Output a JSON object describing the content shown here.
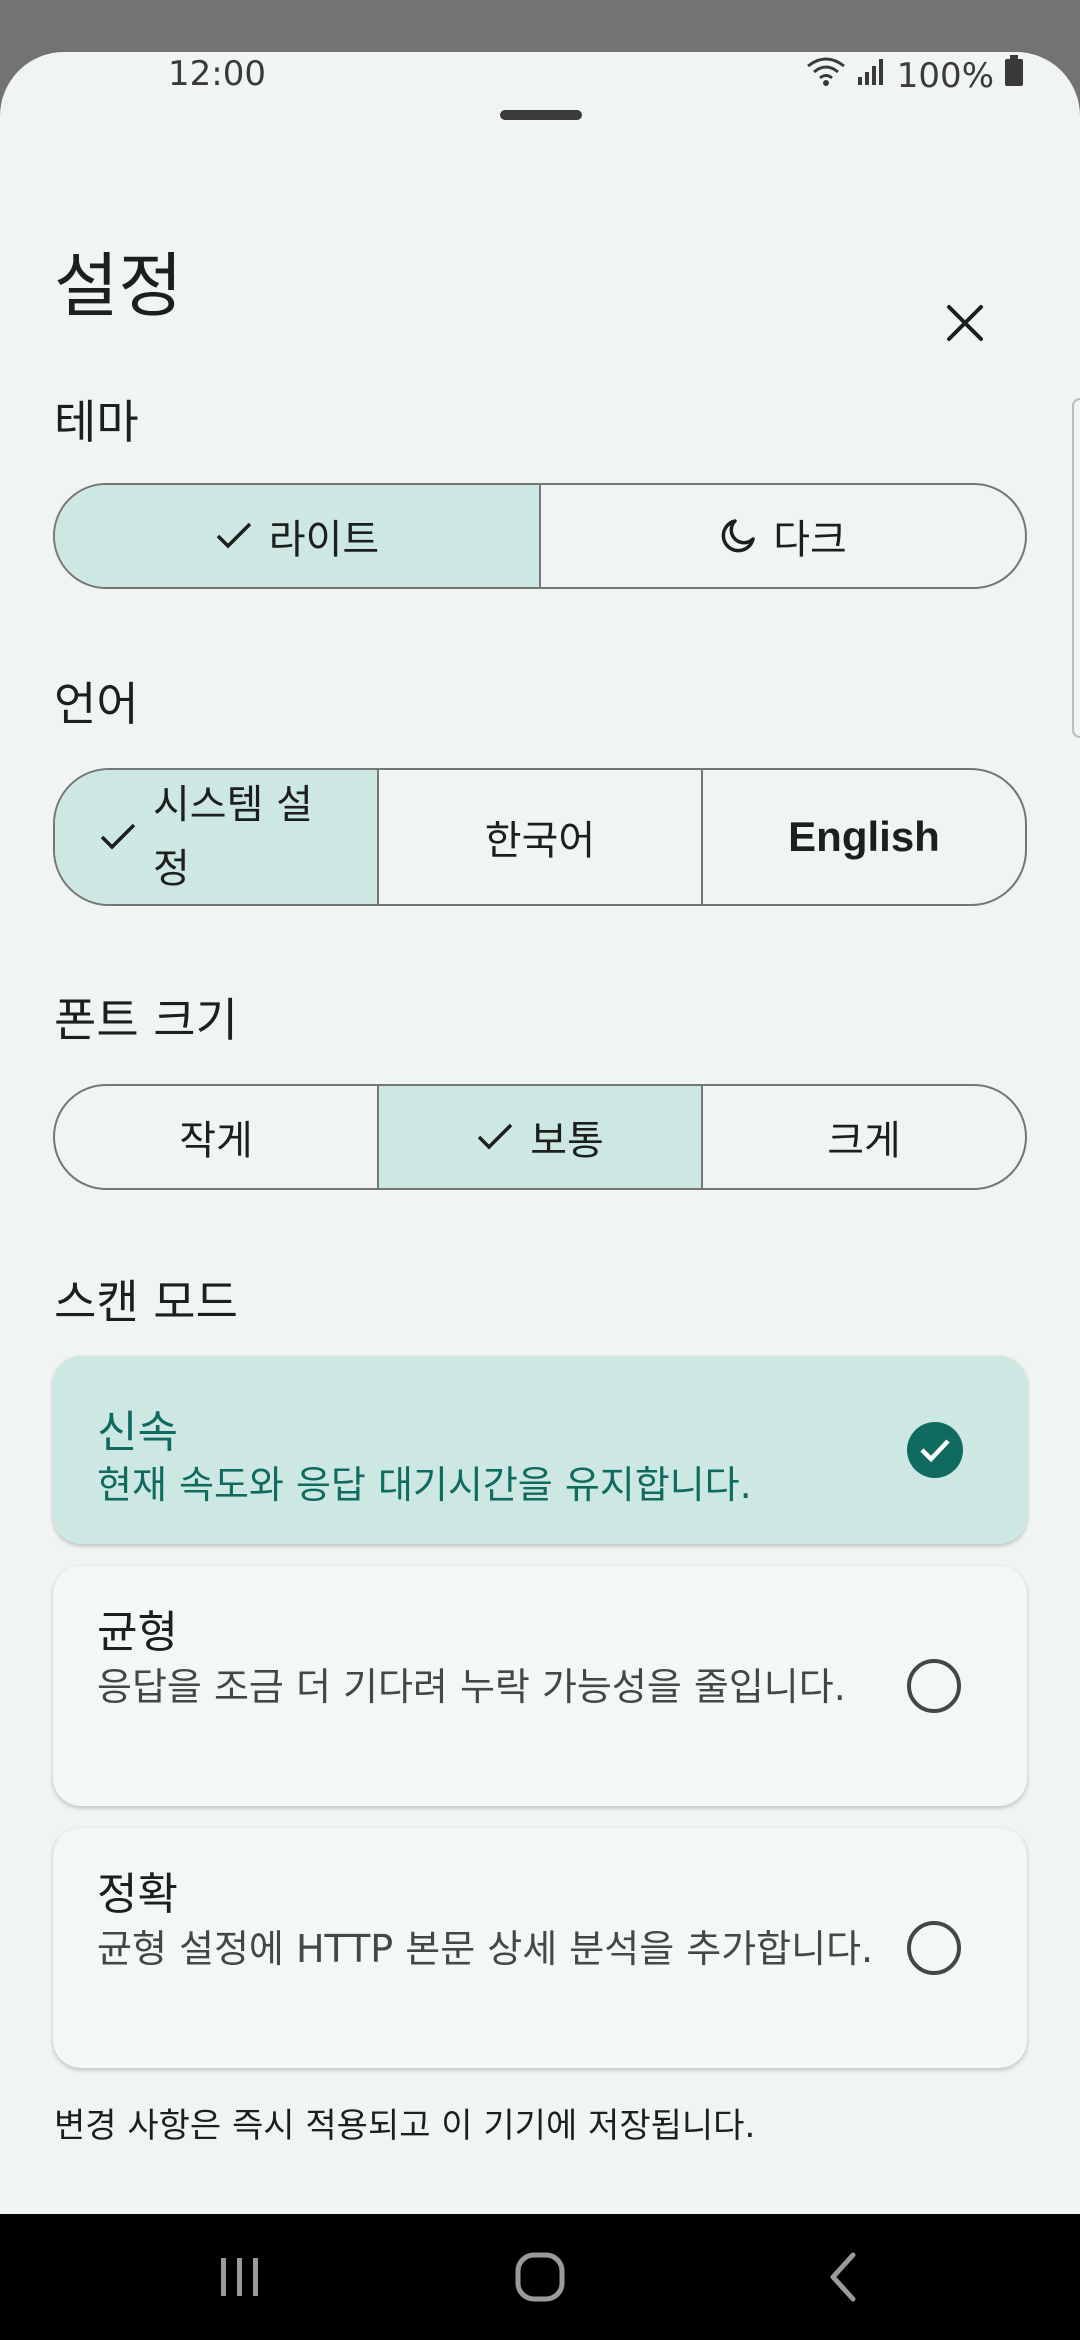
{
  "status": {
    "time": "12:00",
    "battery": "100%"
  },
  "sheet": {
    "title": "설정"
  },
  "theme": {
    "label": "테마",
    "options": [
      {
        "label": "라이트",
        "selected": true,
        "icon": "check-icon"
      },
      {
        "label": "다크",
        "selected": false,
        "icon": "moon-icon"
      }
    ]
  },
  "language": {
    "label": "언어",
    "options": [
      {
        "label": "시스템 설정",
        "selected": true
      },
      {
        "label": "한국어",
        "selected": false
      },
      {
        "label": "English",
        "selected": false
      }
    ]
  },
  "font_size": {
    "label": "폰트 크기",
    "options": [
      {
        "label": "작게",
        "selected": false
      },
      {
        "label": "보통",
        "selected": true
      },
      {
        "label": "크게",
        "selected": false
      }
    ]
  },
  "scan_mode": {
    "label": "스캔 모드",
    "options": [
      {
        "title": "신속",
        "description": "현재 속도와 응답 대기시간을 유지합니다.",
        "selected": true
      },
      {
        "title": "균형",
        "description": "응답을 조금 더 기다려 누락 가능성을 줄입니다.",
        "selected": false
      },
      {
        "title": "정확",
        "description": "균형 설정에 HTTP 본문 상세 분석을 추가합니다.",
        "selected": false
      }
    ]
  },
  "footer_note": "변경 사항은 즉시 적용되고 이 기기에 저장됩니다.",
  "colors": {
    "accent": "#0f6b5f",
    "selected_bg": "#cde7e2",
    "sheet_bg": "#f0f5f3"
  }
}
